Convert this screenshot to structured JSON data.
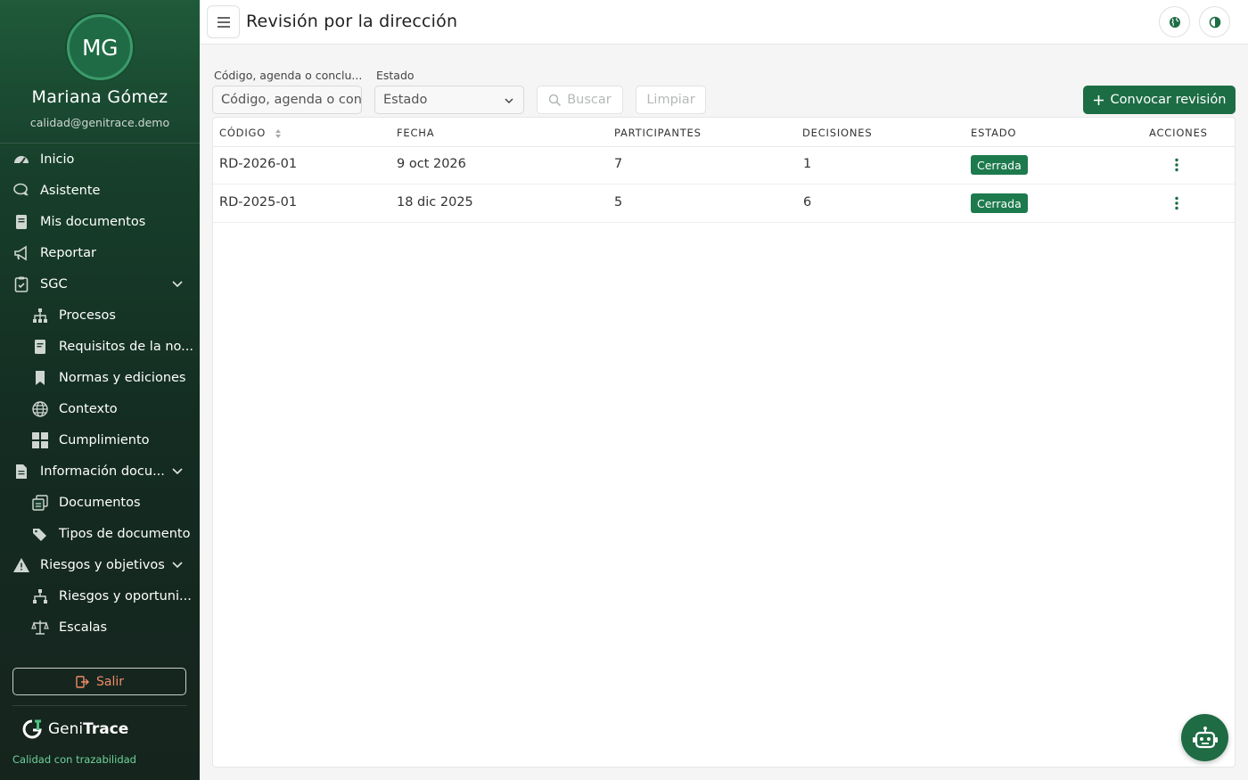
{
  "user": {
    "initials": "MG",
    "name": "Mariana Gómez",
    "email": "calidad@genitrace.demo"
  },
  "nav": [
    {
      "label": "Inicio",
      "icon": "dashboard-icon"
    },
    {
      "label": "Asistente",
      "icon": "chat-icon"
    },
    {
      "label": "Mis documentos",
      "icon": "document-icon"
    },
    {
      "label": "Reportar",
      "icon": "megaphone-icon"
    },
    {
      "label": "SGC",
      "icon": "clipboard-check-icon"
    },
    {
      "label": "Procesos",
      "icon": "sitemap-icon"
    },
    {
      "label": "Requisitos de la no...",
      "icon": "file-icon"
    },
    {
      "label": "Normas y ediciones",
      "icon": "bookmark-icon"
    },
    {
      "label": "Contexto",
      "icon": "globe-icon"
    },
    {
      "label": "Cumplimiento",
      "icon": "grid-icon"
    },
    {
      "label": "Información docu...",
      "icon": "file-text-icon"
    },
    {
      "label": "Documentos",
      "icon": "documents-stack-icon"
    },
    {
      "label": "Tipos de documento",
      "icon": "tags-icon"
    },
    {
      "label": "Riesgos y objetivos",
      "icon": "warning-icon"
    },
    {
      "label": "Riesgos y oportuni...",
      "icon": "sitemap-icon"
    },
    {
      "label": "Escalas",
      "icon": "scale-icon"
    }
  ],
  "logout_label": "Salir",
  "brand": {
    "prefix": "Geni",
    "bold": "Trace",
    "tagline": "Calidad con trazabilidad"
  },
  "header": {
    "title": "Revisión por la dirección"
  },
  "filters": {
    "search_label": "Código, agenda o conclu...",
    "search_placeholder": "Código, agenda o conc",
    "status_label": "Estado",
    "status_value": "Estado",
    "search_button": "Buscar",
    "clear_button": "Limpiar",
    "create_button": "Convocar revisión"
  },
  "table": {
    "headers": [
      "CÓDIGO",
      "FECHA",
      "PARTICIPANTES",
      "DECISIONES",
      "ESTADO",
      "ACCIONES"
    ],
    "rows": [
      {
        "code": "RD-2026-01",
        "date": "9 oct 2026",
        "participants": "7",
        "decisions": "1",
        "status": "Cerrada"
      },
      {
        "code": "RD-2025-01",
        "date": "18 dic 2025",
        "participants": "5",
        "decisions": "6",
        "status": "Cerrada"
      }
    ]
  },
  "colors": {
    "primary": "#1d6d44",
    "badge": "#1d7a4c",
    "logout": "#f08a66",
    "tagline": "#6dd39a"
  }
}
